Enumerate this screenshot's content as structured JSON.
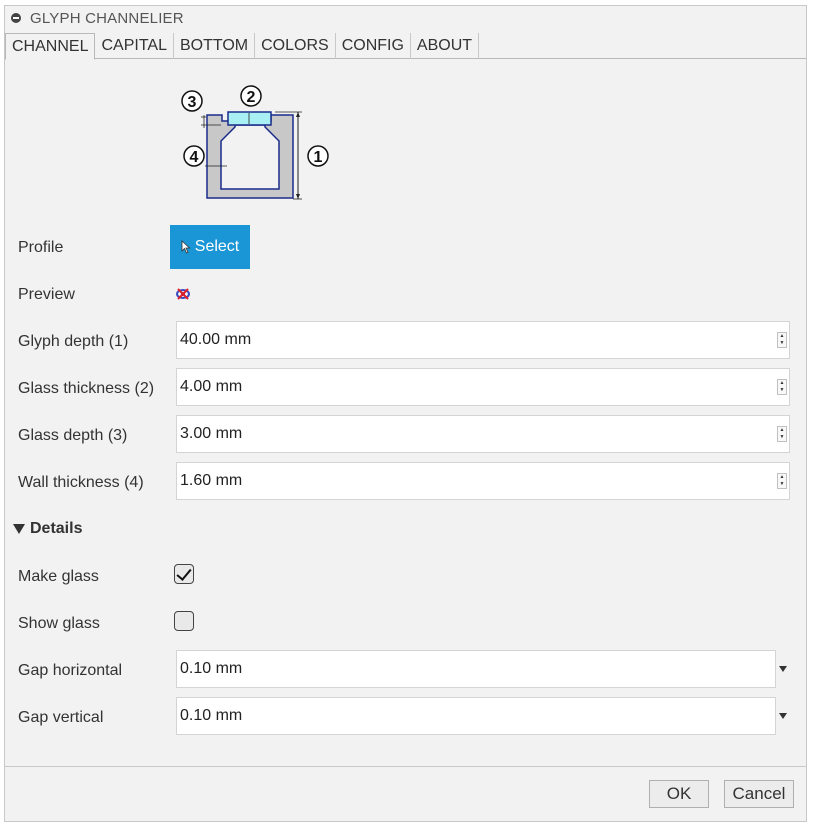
{
  "window": {
    "title": "GLYPH CHANNELIER"
  },
  "tabs": [
    {
      "label": "CHANNEL"
    },
    {
      "label": "CAPITAL"
    },
    {
      "label": "BOTTOM"
    },
    {
      "label": "COLORS"
    },
    {
      "label": "CONFIG"
    },
    {
      "label": "ABOUT"
    }
  ],
  "diagram": {
    "markers": [
      "1",
      "2",
      "3",
      "4"
    ]
  },
  "profile": {
    "label": "Profile",
    "button_label": "Select"
  },
  "preview": {
    "label": "Preview",
    "icon": "preview-off-icon"
  },
  "fields": [
    {
      "label": "Glyph depth (1)",
      "value": "40.00 mm"
    },
    {
      "label": "Glass thickness (2)",
      "value": "4.00 mm"
    },
    {
      "label": "Glass depth (3)",
      "value": "3.00 mm"
    },
    {
      "label": "Wall thickness (4)",
      "value": "1.60 mm"
    }
  ],
  "details": {
    "label": "Details",
    "make_glass": {
      "label": "Make glass",
      "checked": true
    },
    "show_glass": {
      "label": "Show glass",
      "checked": false
    },
    "gap_horizontal": {
      "label": "Gap horizontal",
      "value": "0.10 mm"
    },
    "gap_vertical": {
      "label": "Gap vertical",
      "value": "0.10 mm"
    }
  },
  "footer": {
    "ok_label": "OK",
    "cancel_label": "Cancel"
  },
  "colors": {
    "accent": "#1a96d6",
    "glass_fill": "#a8f0f4",
    "profile_stroke": "#1a2a8a"
  }
}
